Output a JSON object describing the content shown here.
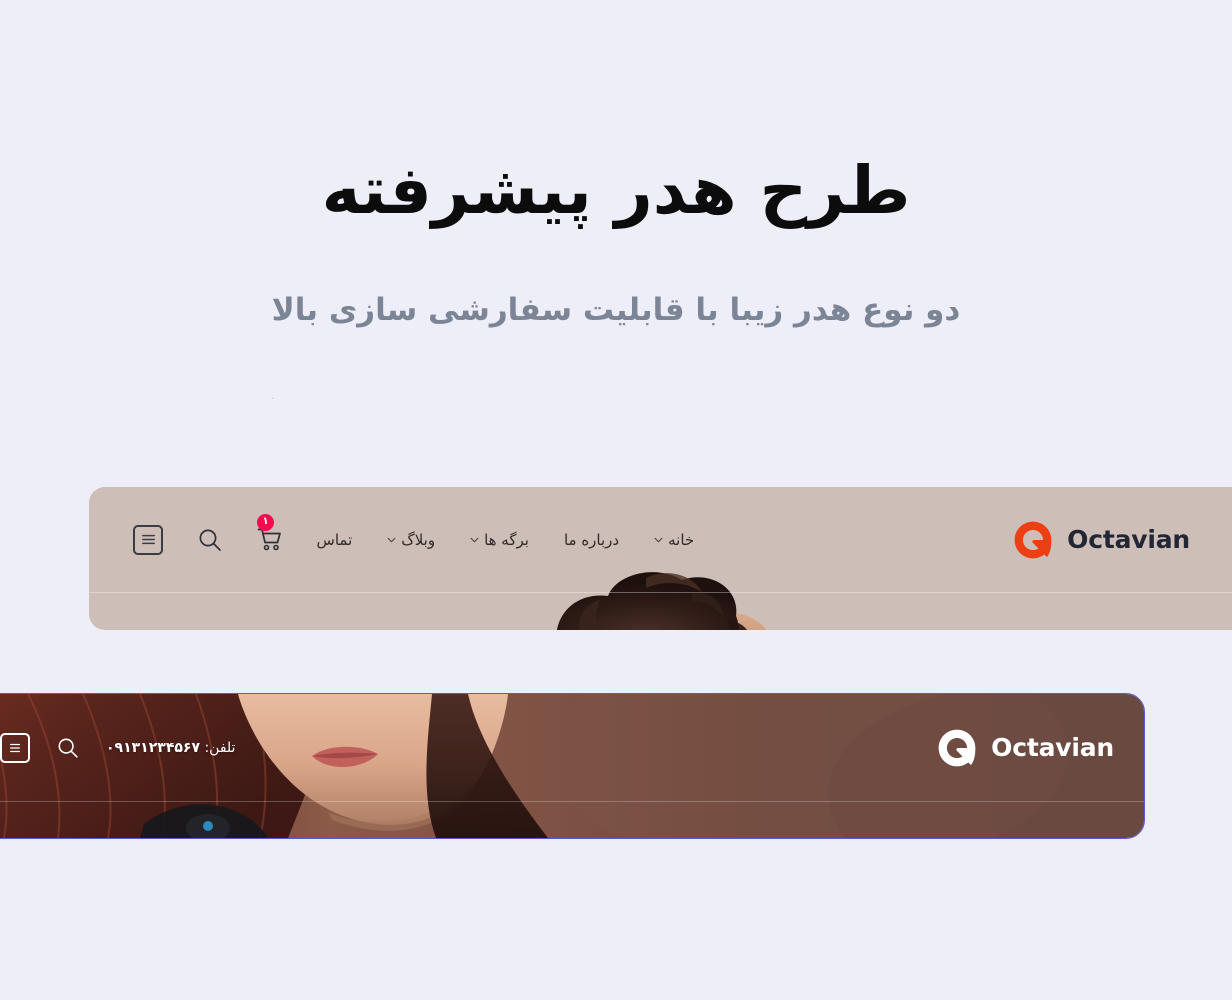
{
  "page": {
    "background_color": "#eeeef8",
    "title": "طرح هدر پیشرفته",
    "subtitle": "دو نوع هدر زیبا با قابلیت سفارشی سازی بالا",
    "stray_dot": "."
  },
  "brand": {
    "name": "Octavian",
    "mark_icon": "octavian-q-logo-icon",
    "mark_color_primary": "#ee3e13",
    "mark_color_light": "#ffffff",
    "text_color_dark": "#232735",
    "text_color_light": "#ffffff"
  },
  "header_one": {
    "background_color": "#cdbfb8",
    "nav": [
      {
        "label": "خانه",
        "has_dropdown": true
      },
      {
        "label": "درباره ما",
        "has_dropdown": false
      },
      {
        "label": "برگه ها",
        "has_dropdown": true
      },
      {
        "label": "وبلاگ",
        "has_dropdown": true
      },
      {
        "label": "تماس",
        "has_dropdown": false
      }
    ],
    "actions": {
      "menu_icon": "hamburger-menu-icon",
      "search_icon": "search-icon",
      "cart_icon": "shopping-cart-icon",
      "cart_badge": "۱",
      "cart_badge_color": "#f50b4e"
    }
  },
  "header_two": {
    "overlay_color": "#6b4a42",
    "phone_label": "تلفن:",
    "phone_number": "۰۹۱۳۱۲۳۴۵۶۷",
    "actions": {
      "menu_icon": "hamburger-menu-icon",
      "search_icon": "search-icon"
    }
  }
}
